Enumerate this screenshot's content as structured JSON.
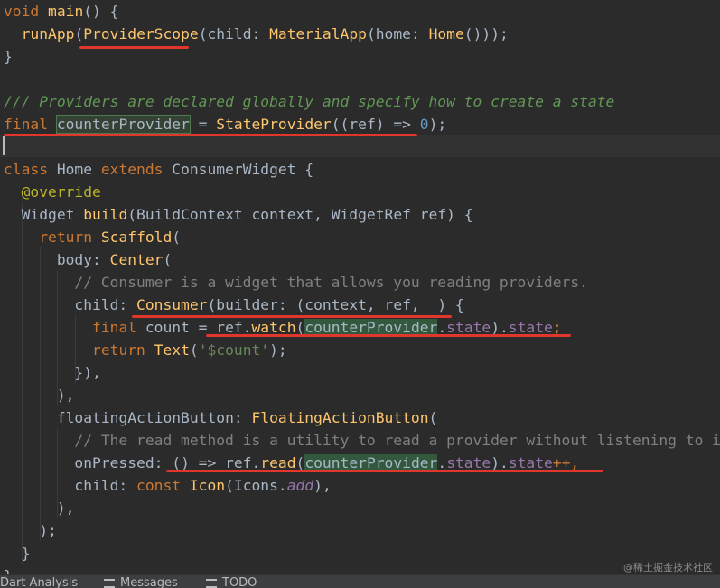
{
  "code": {
    "line1": {
      "kw": "void",
      "fn": "main",
      "rest": "() {"
    },
    "line2": {
      "indent": "  ",
      "fn": "runApp",
      "p1": "(",
      "cls1": "ProviderScope",
      "p2": "(child: ",
      "cls2": "MaterialApp",
      "p3": "(home: ",
      "cls3": "Home",
      "p4": "()));"
    },
    "line3": "}",
    "line5": "/// Providers are declared globally and specify how to create a state",
    "line6": {
      "kw": "final",
      "name": "counterProvider",
      "eq": " = ",
      "cls": "StateProvider",
      "p1": "((ref) => ",
      "num": "0",
      "p2": ");"
    },
    "line8": {
      "kw1": "class",
      "name": " Home ",
      "kw2": "extends",
      "cls": " ConsumerWidget {"
    },
    "line9": {
      "indent": "  ",
      "ann": "@override"
    },
    "line10": {
      "indent": "  ",
      "type": "Widget ",
      "fn": "build",
      "rest": "(BuildContext context, WidgetRef ref) {"
    },
    "line11": {
      "indent": "    ",
      "kw": "return",
      "sp": " ",
      "fn": "Scaffold",
      "rest": "("
    },
    "line12": {
      "indent": "      ",
      "p": "body: ",
      "fn": "Center",
      "rest": "("
    },
    "line13": {
      "indent": "        ",
      "cmt": "// Consumer is a widget that allows you reading providers."
    },
    "line14": {
      "indent": "        ",
      "p": "child: ",
      "fn": "Consumer",
      "rest": "(builder: (context, ref, _) {"
    },
    "line15": {
      "indent": "          ",
      "kw": "final",
      "p1": " count = ref.",
      "fn": "watch",
      "p2": "(",
      "hl": "counterProvider",
      "p3": ".",
      "prop1": "state",
      "p4": ").",
      "prop2": "state",
      "end": ";"
    },
    "line16": {
      "indent": "          ",
      "kw": "return",
      "sp": " ",
      "fn": "Text",
      "p1": "(",
      "str": "'$count'",
      "p2": ");"
    },
    "line17": {
      "indent": "        ",
      "p": "}),"
    },
    "line18": {
      "indent": "      ",
      "p": "),"
    },
    "line19": {
      "indent": "      ",
      "p": "floatingActionButton: ",
      "fn": "FloatingActionButton",
      "rest": "("
    },
    "line20": {
      "indent": "        ",
      "cmt": "// The read method is a utility to read a provider without listening to it"
    },
    "line21": {
      "indent": "        ",
      "fn": "onPressed",
      "p1": ": () => ref.",
      "fn2": "read",
      "p2": "(",
      "hl": "counterProvider",
      "p3": ".",
      "prop1": "state",
      "p4": ").",
      "prop2": "state",
      "end": "++,"
    },
    "line22": {
      "indent": "        ",
      "p": "child: ",
      "kw": "const",
      "sp": " ",
      "fn": "Icon",
      "p2": "(Icons.",
      "prop": "add",
      "p3": "),"
    },
    "line23": {
      "indent": "      ",
      "p": "),"
    },
    "line24": {
      "indent": "    ",
      "p": ");"
    },
    "line25": {
      "indent": "  ",
      "p": "}"
    },
    "line26": "}"
  },
  "bottom_tabs": [
    "Dart Analysis",
    "Messages",
    "TODO"
  ],
  "watermark": "@稀土掘金技术社区",
  "colors": {
    "background": "#2b2b2b",
    "underline": "#e0362b",
    "keyword": "#cc7832",
    "function": "#ffc66d",
    "comment": "#808080",
    "doc_comment": "#629755",
    "property": "#9876aa",
    "number": "#6897bb"
  }
}
